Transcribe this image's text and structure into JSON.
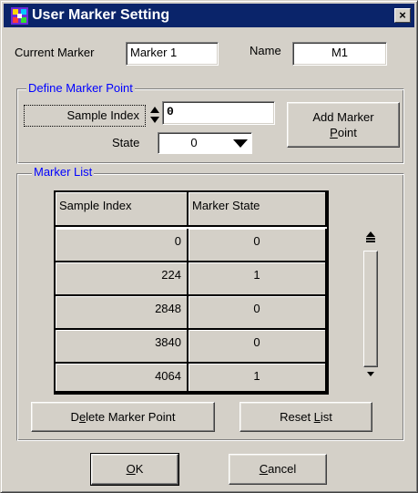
{
  "window": {
    "title": "User Marker Setting",
    "close_label": "×",
    "icons": {
      "app": "marker-app-icon",
      "close": "close-icon"
    },
    "colors": {
      "titlebar": "#0a246a",
      "face": "#d4d0c8",
      "group_title": "#0000ff"
    }
  },
  "marker": {
    "current_label": "Current Marker",
    "current_value": "Marker 1",
    "name_label": "Name",
    "name_value": "M1"
  },
  "define": {
    "title": "Define Marker Point",
    "sample_index_label": "Sample Index",
    "sample_index_value": "0",
    "state_label": "State",
    "state_value": "0",
    "add_button_line1": "Add Marker",
    "add_button_line2": "Point",
    "add_button_line2_mnemonic": "P",
    "add_button_line2_rest": "oint"
  },
  "list": {
    "title": "Marker List",
    "columns": [
      "Sample Index",
      "Marker State"
    ],
    "rows": [
      {
        "index": "0",
        "state": "0"
      },
      {
        "index": "224",
        "state": "1"
      },
      {
        "index": "2848",
        "state": "0"
      },
      {
        "index": "3840",
        "state": "0"
      },
      {
        "index": "4064",
        "state": "1"
      }
    ],
    "delete_button": {
      "pre": "D",
      "mnemonic": "e",
      "post": "lete Marker Point"
    },
    "reset_button": {
      "pre": "Reset ",
      "mnemonic": "L",
      "post": "ist"
    }
  },
  "footer": {
    "ok": {
      "mnemonic": "O",
      "post": "K"
    },
    "cancel": {
      "mnemonic": "C",
      "post": "ancel"
    }
  }
}
